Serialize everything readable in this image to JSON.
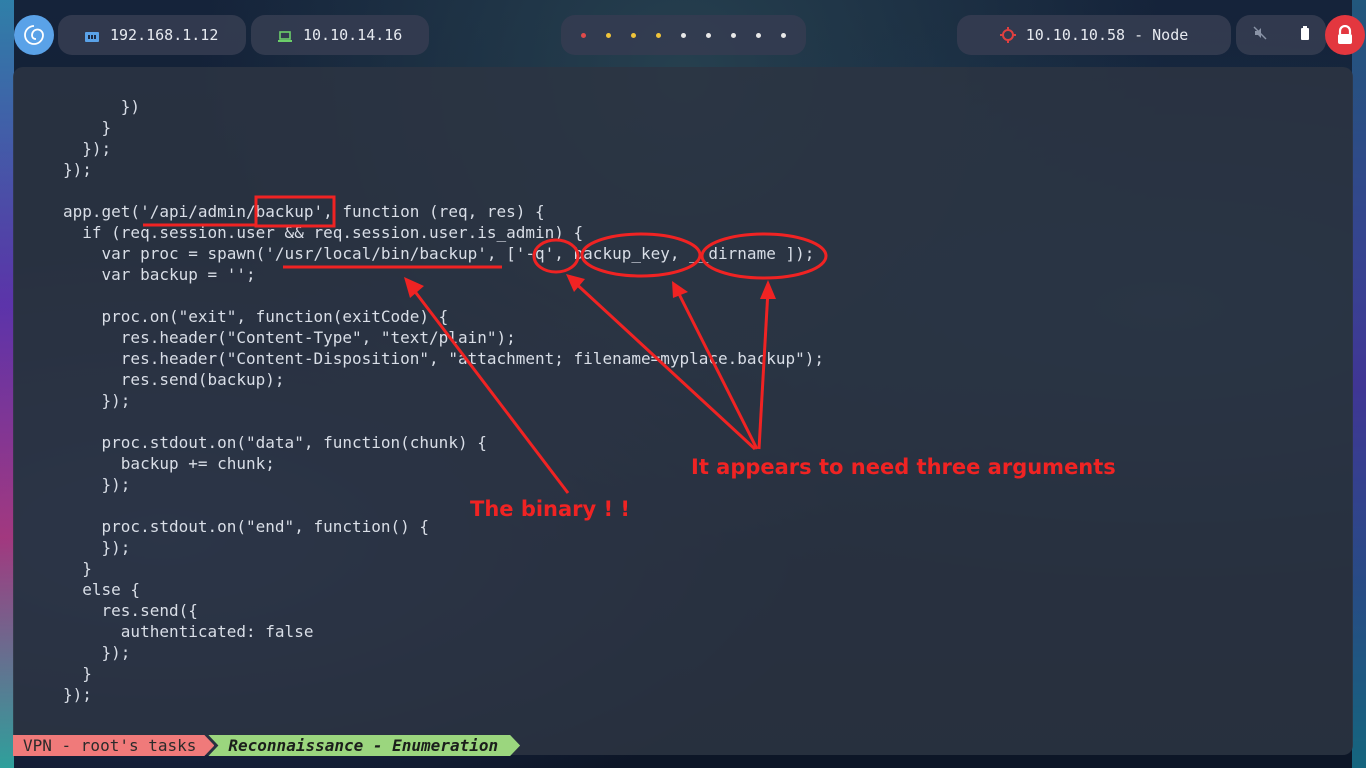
{
  "topbar": {
    "logo_icon": "debian-swirl-icon",
    "local_ip": "192.168.1.12",
    "vpn_ip": "10.10.14.16",
    "workspaces": [
      "red",
      "yellow",
      "yellow",
      "yellow",
      "white",
      "white",
      "white",
      "white",
      "white"
    ],
    "workspace_colors": {
      "red": "#e04a4a",
      "yellow": "#f0c43a",
      "white": "#e8e8e8"
    },
    "target_label": "10.10.10.58 - Node",
    "target_icon": "crosshair-icon",
    "mute_icon": "speaker-muted-icon",
    "battery_icon": "battery-icon",
    "lock_icon": "padlock-icon"
  },
  "terminal": {
    "code_lines": [
      "      })",
      "    }",
      "  });",
      "});",
      "",
      "app.get('/api/admin/backup', function (req, res) {",
      "  if (req.session.user && req.session.user.is_admin) {",
      "    var proc = spawn('/usr/local/bin/backup', ['-q', backup_key, __dirname ]);",
      "    var backup = '';",
      "",
      "    proc.on(\"exit\", function(exitCode) {",
      "      res.header(\"Content-Type\", \"text/plain\");",
      "      res.header(\"Content-Disposition\", \"attachment; filename=myplace.backup\");",
      "      res.send(backup);",
      "    });",
      "",
      "    proc.stdout.on(\"data\", function(chunk) {",
      "      backup += chunk;",
      "    });",
      "",
      "    proc.stdout.on(\"end\", function() {",
      "    });",
      "  }",
      "  else {",
      "    res.send({",
      "      authenticated: false",
      "    });",
      "  }",
      "});"
    ],
    "annotations": {
      "binary_label": "The binary ! !",
      "arguments_label": "It appears to need three arguments",
      "color": "#f02323"
    }
  },
  "statusbar": {
    "session": "VPN - root's tasks",
    "window": "Reconnaissance - Enumeration"
  }
}
